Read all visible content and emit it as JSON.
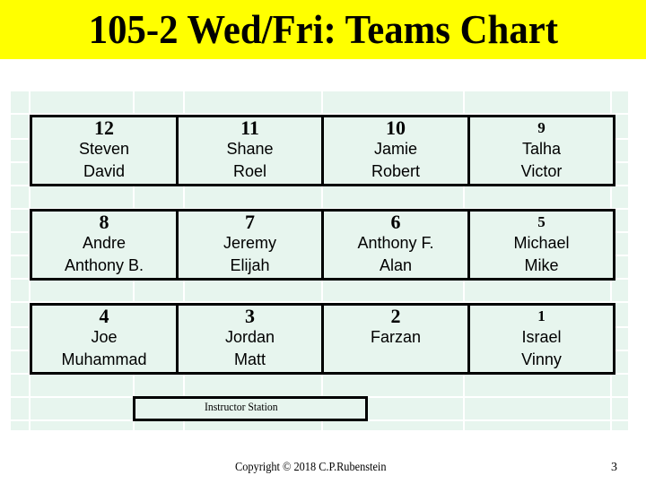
{
  "title": "105-2 Wed/Fri: Teams Chart",
  "colors": {
    "title_background": "#ffff00",
    "grid_background": "#e7f5ee",
    "border": "#000000"
  },
  "teams": [
    {
      "number": "12",
      "members": [
        "Steven",
        "David"
      ]
    },
    {
      "number": "11",
      "members": [
        "Shane",
        "Roel"
      ]
    },
    {
      "number": "10",
      "members": [
        "Jamie",
        "Robert"
      ]
    },
    {
      "number": "9",
      "members": [
        "Talha",
        "Victor"
      ]
    },
    {
      "number": "8",
      "members": [
        "Andre",
        "Anthony B."
      ]
    },
    {
      "number": "7",
      "members": [
        "Jeremy",
        "Elijah"
      ]
    },
    {
      "number": "6",
      "members": [
        "Anthony F.",
        "Alan"
      ]
    },
    {
      "number": "5",
      "members": [
        "Michael",
        "Mike"
      ]
    },
    {
      "number": "4",
      "members": [
        "Joe",
        "Muhammad"
      ]
    },
    {
      "number": "3",
      "members": [
        "Jordan",
        "Matt"
      ]
    },
    {
      "number": "2",
      "members": [
        "Farzan"
      ]
    },
    {
      "number": "1",
      "members": [
        "Israel",
        "Vinny"
      ]
    }
  ],
  "instructor_station": "Instructor Station",
  "footer": {
    "copyright": "Copyright © 2018 C.P.Rubenstein",
    "page_number": "3"
  }
}
